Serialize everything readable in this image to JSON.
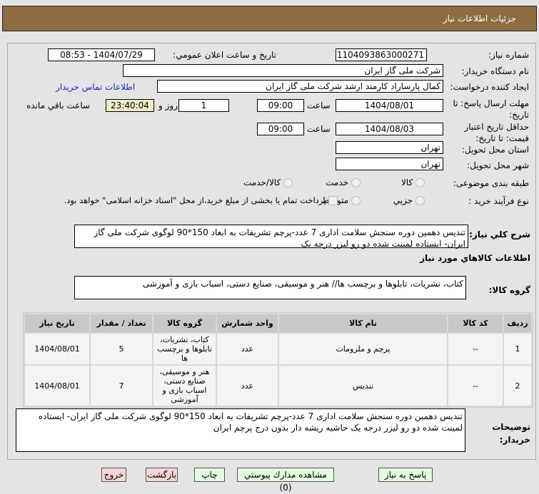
{
  "header": {
    "title": "جزئیات اطلاعات نیاز"
  },
  "form": {
    "need_number_label": "شماره نیاز:",
    "need_number": "1104093863000271",
    "announce_label": "تاریخ و ساعت اعلان عمومي:",
    "announce_value": "1404/07/29 - 08:53",
    "buyer_label": "نام دستگاه خریدار:",
    "buyer": "شرکت ملی گاز ایران",
    "creator_label": "ایجاد کننده درخواست:",
    "creator": "کمال پارساراد کارمند ارشد شرکت ملی گاز ایران",
    "contact_link": "اطلاعات تماس خریدار",
    "deadline_label": "مهلت ارسال پاسخ: تا تاریخ:",
    "deadline_date": "1404/08/01",
    "time_label": "ساعت",
    "deadline_time": "09:00",
    "days": "1",
    "days_label": "روز و",
    "remaining": "23:40:04",
    "remaining_label": "ساعت باقي مانده",
    "validity_label": "حداقل تاریخ اعتبار قیمت: تا تاریخ:",
    "validity_date": "1404/08/03",
    "validity_time": "09:00",
    "province_label": "استان محل تحویل:",
    "province": "تهران",
    "city_label": "شهر محل تحویل:",
    "city": "تهران",
    "category_label": "طبقه بندی موضوعی:",
    "category_options": [
      "کالا",
      "خدمت",
      "کالا/خدمت"
    ],
    "process_label": "نوع فرآیند خرید :",
    "process_options": [
      "جزیي",
      "متوسط"
    ],
    "payment_note": "پرداخت تمام یا بخشی از مبلغ خرید،از محل \"اسناد خزانه اسلامی\" خواهد بود.",
    "description_label": "شرح کلي نیاز:",
    "description": "تندیس دهمین دوره سنجش سلامت اداری 7 عدد-پرچم تشریفات به ابعاد 150*90 لوگوی شرکت ملی گاز ایران- ایستاده لمینت شده دو رو لیزر درجه یک",
    "goods_info_title": "اطلاعات کالاهاي مورد نیاز",
    "goods_group_label": "گروه کالا:",
    "goods_group": "کتاب، نشریات، تابلوها و برچسب ها// هنر و موسیقی، صنایع دستی، اسباب بازی و آموزشی",
    "notes_label": "توضیحات خریدار:",
    "notes": "تندیس دهمین دوره سنجش سلامت اداری 7 عدد-پرچم تشریفات به ابعاد 150*90 لوگوی شرکت ملی گاز ایران- ایستاده لمینت شده دو رو لیزر درجه یک حاشیه ریشه دار بدون درج پرچم ایران"
  },
  "table": {
    "headers": [
      "ردیف",
      "کد کالا",
      "نام کالا",
      "واحد شمارش",
      "گروه کالا",
      "تعداد / مقدار",
      "تاریخ نیاز"
    ],
    "rows": [
      [
        "1",
        "--",
        "پرچم و ملزومات",
        "عدد",
        "کتاب، نشریات، تابلوها و برچسب ها",
        "5",
        "1404/08/01"
      ],
      [
        "2",
        "--",
        "تندیس",
        "عدد",
        "هنر و موسیقی، صنایع دستی، اسباب بازی و آموزشی",
        "7",
        "1404/08/01"
      ]
    ]
  },
  "buttons": {
    "reply": "پاسخ به نیاز",
    "attachments": "مشاهده مدارك پیوستي (0)",
    "print": "چاپ",
    "back": "بازگشت",
    "exit": "خروج"
  }
}
